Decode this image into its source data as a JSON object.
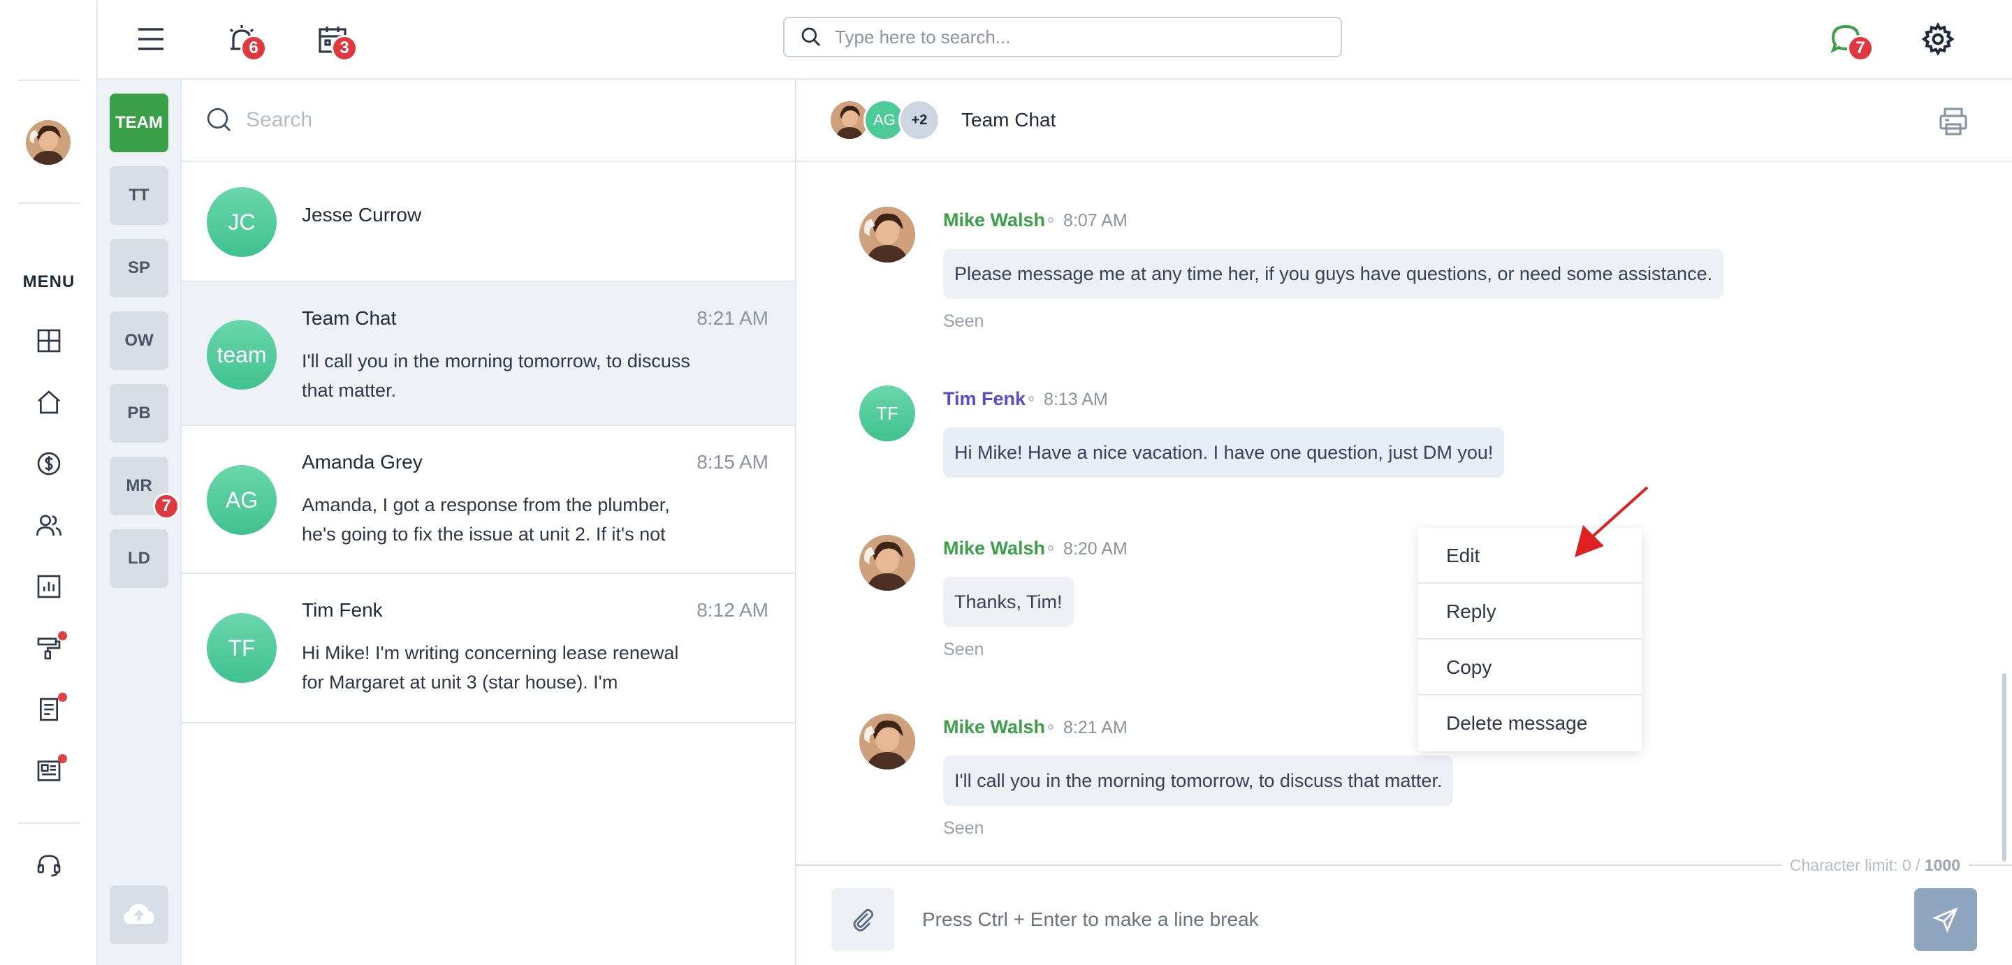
{
  "nav": {
    "menu_label": "MENU"
  },
  "topbar": {
    "alerts_count": "6",
    "calendar_count": "3",
    "search_placeholder": "Type here to search...",
    "chat_count": "7"
  },
  "channels": {
    "items": [
      {
        "label": "TEAM",
        "active": true
      },
      {
        "label": "TT"
      },
      {
        "label": "SP"
      },
      {
        "label": "OW"
      },
      {
        "label": "PB"
      },
      {
        "label": "MR",
        "badge": "7"
      },
      {
        "label": "LD"
      }
    ]
  },
  "conversations": {
    "search_placeholder": "Search",
    "items": [
      {
        "initials": "JC",
        "name": "Jesse Currow",
        "time": "",
        "preview": ""
      },
      {
        "initials": "team",
        "name": "Team Chat",
        "time": "8:21 AM",
        "preview": "I'll call you in the morning tomorrow, to discuss that matter."
      },
      {
        "initials": "AG",
        "name": "Amanda Grey",
        "time": "8:15 AM",
        "preview": "Amanda, I got a response from the plumber, he's going to fix the issue at unit 2. If it's not"
      },
      {
        "initials": "TF",
        "name": "Tim Fenk",
        "time": "8:12 AM",
        "preview": "Hi Mike! I'm writing concerning lease renewal for Margaret at unit 3 (star house). I'm"
      }
    ]
  },
  "chat": {
    "title": "Team Chat",
    "participants": {
      "second": "AG",
      "more": "+2"
    },
    "messages": [
      {
        "author": "Mike Walsh",
        "time": "8:07 AM",
        "text": "Please message me at any time her, if you guys have questions, or need some assistance.",
        "status": "Seen"
      },
      {
        "author": "Tim Fenk",
        "initials": "TF",
        "time": "8:13 AM",
        "text": "Hi Mike! Have a nice vacation. I have one question, just DM you!",
        "status": ""
      },
      {
        "author": "Mike Walsh",
        "time": "8:20 AM",
        "text": "Thanks, Tim!",
        "status": "Seen"
      },
      {
        "author": "Mike Walsh",
        "time": "8:21 AM",
        "text": "I'll call you in the morning tomorrow, to discuss that matter.",
        "status": "Seen"
      }
    ],
    "context_menu": [
      "Edit",
      "Reply",
      "Copy",
      "Delete message"
    ],
    "char_limit": {
      "label": "Character limit: 0 /",
      "max": "1000"
    },
    "composer_placeholder": "Press Ctrl + Enter to make a line break"
  },
  "colors": {
    "accent_green": "#3aa048",
    "badge_red": "#e0383e",
    "avatar_teal": "#4ccb98",
    "purple_name": "#5b4ad1"
  },
  "icons": {
    "hamburger": "hamburger-icon",
    "alerts": "alarm-icon",
    "calendar": "calendar-icon",
    "chat": "chat-bubble-icon",
    "settings": "gear-icon",
    "search": "search-icon",
    "print": "printer-icon",
    "attach": "paperclip-icon",
    "send": "send-icon",
    "upload": "cloud-upload-icon"
  }
}
